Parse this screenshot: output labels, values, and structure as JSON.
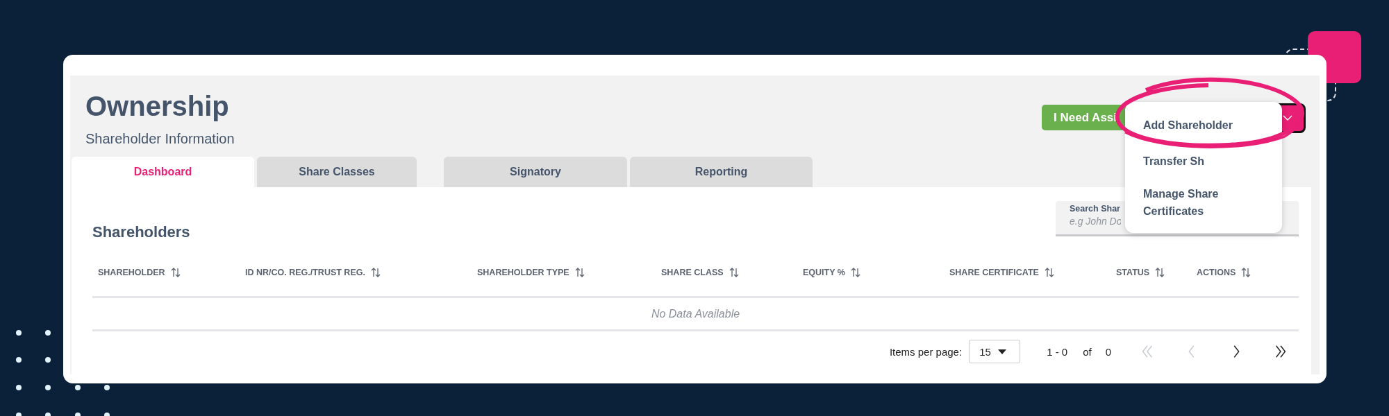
{
  "page": {
    "title": "Ownership",
    "subtitle": "Shareholder Information"
  },
  "header_buttons": [
    {
      "kind": "assist",
      "label": "I Need Assi"
    },
    {
      "kind": "menu"
    }
  ],
  "tabs": [
    {
      "label": "Dashboard",
      "selected": true
    },
    {
      "label": "Share Classes",
      "selected": false
    },
    {
      "label": "Signatory",
      "selected": false
    },
    {
      "label": "Reporting",
      "selected": false
    }
  ],
  "dropdown_menu": {
    "items": [
      "Add Shareholder",
      "Transfer Sh",
      "Manage Share Certificates"
    ]
  },
  "shareholders": {
    "title": "Shareholders",
    "search": {
      "label": "Search Shar",
      "placeholder": "e.g John Do"
    },
    "table": {
      "columns": [
        "SHAREHOLDER",
        "ID NR/CO. REG./TRUST REG.",
        "SHAREHOLDER TYPE",
        "SHARE CLASS",
        "EQUITY %",
        "SHARE CERTIFICATE",
        "STATUS",
        "ACTIONS"
      ],
      "empty_message": "No Data Available"
    }
  },
  "pagination": {
    "items_per_page_label": "Items per page:",
    "page_size": "15",
    "range": "1 - 0",
    "of_label": "of",
    "total": "0",
    "buttons": [
      {
        "kind": "first",
        "disabled": true
      },
      {
        "kind": "previous",
        "disabled": true
      },
      {
        "kind": "next",
        "disabled": false
      },
      {
        "kind": "last",
        "disabled": false
      }
    ]
  }
}
